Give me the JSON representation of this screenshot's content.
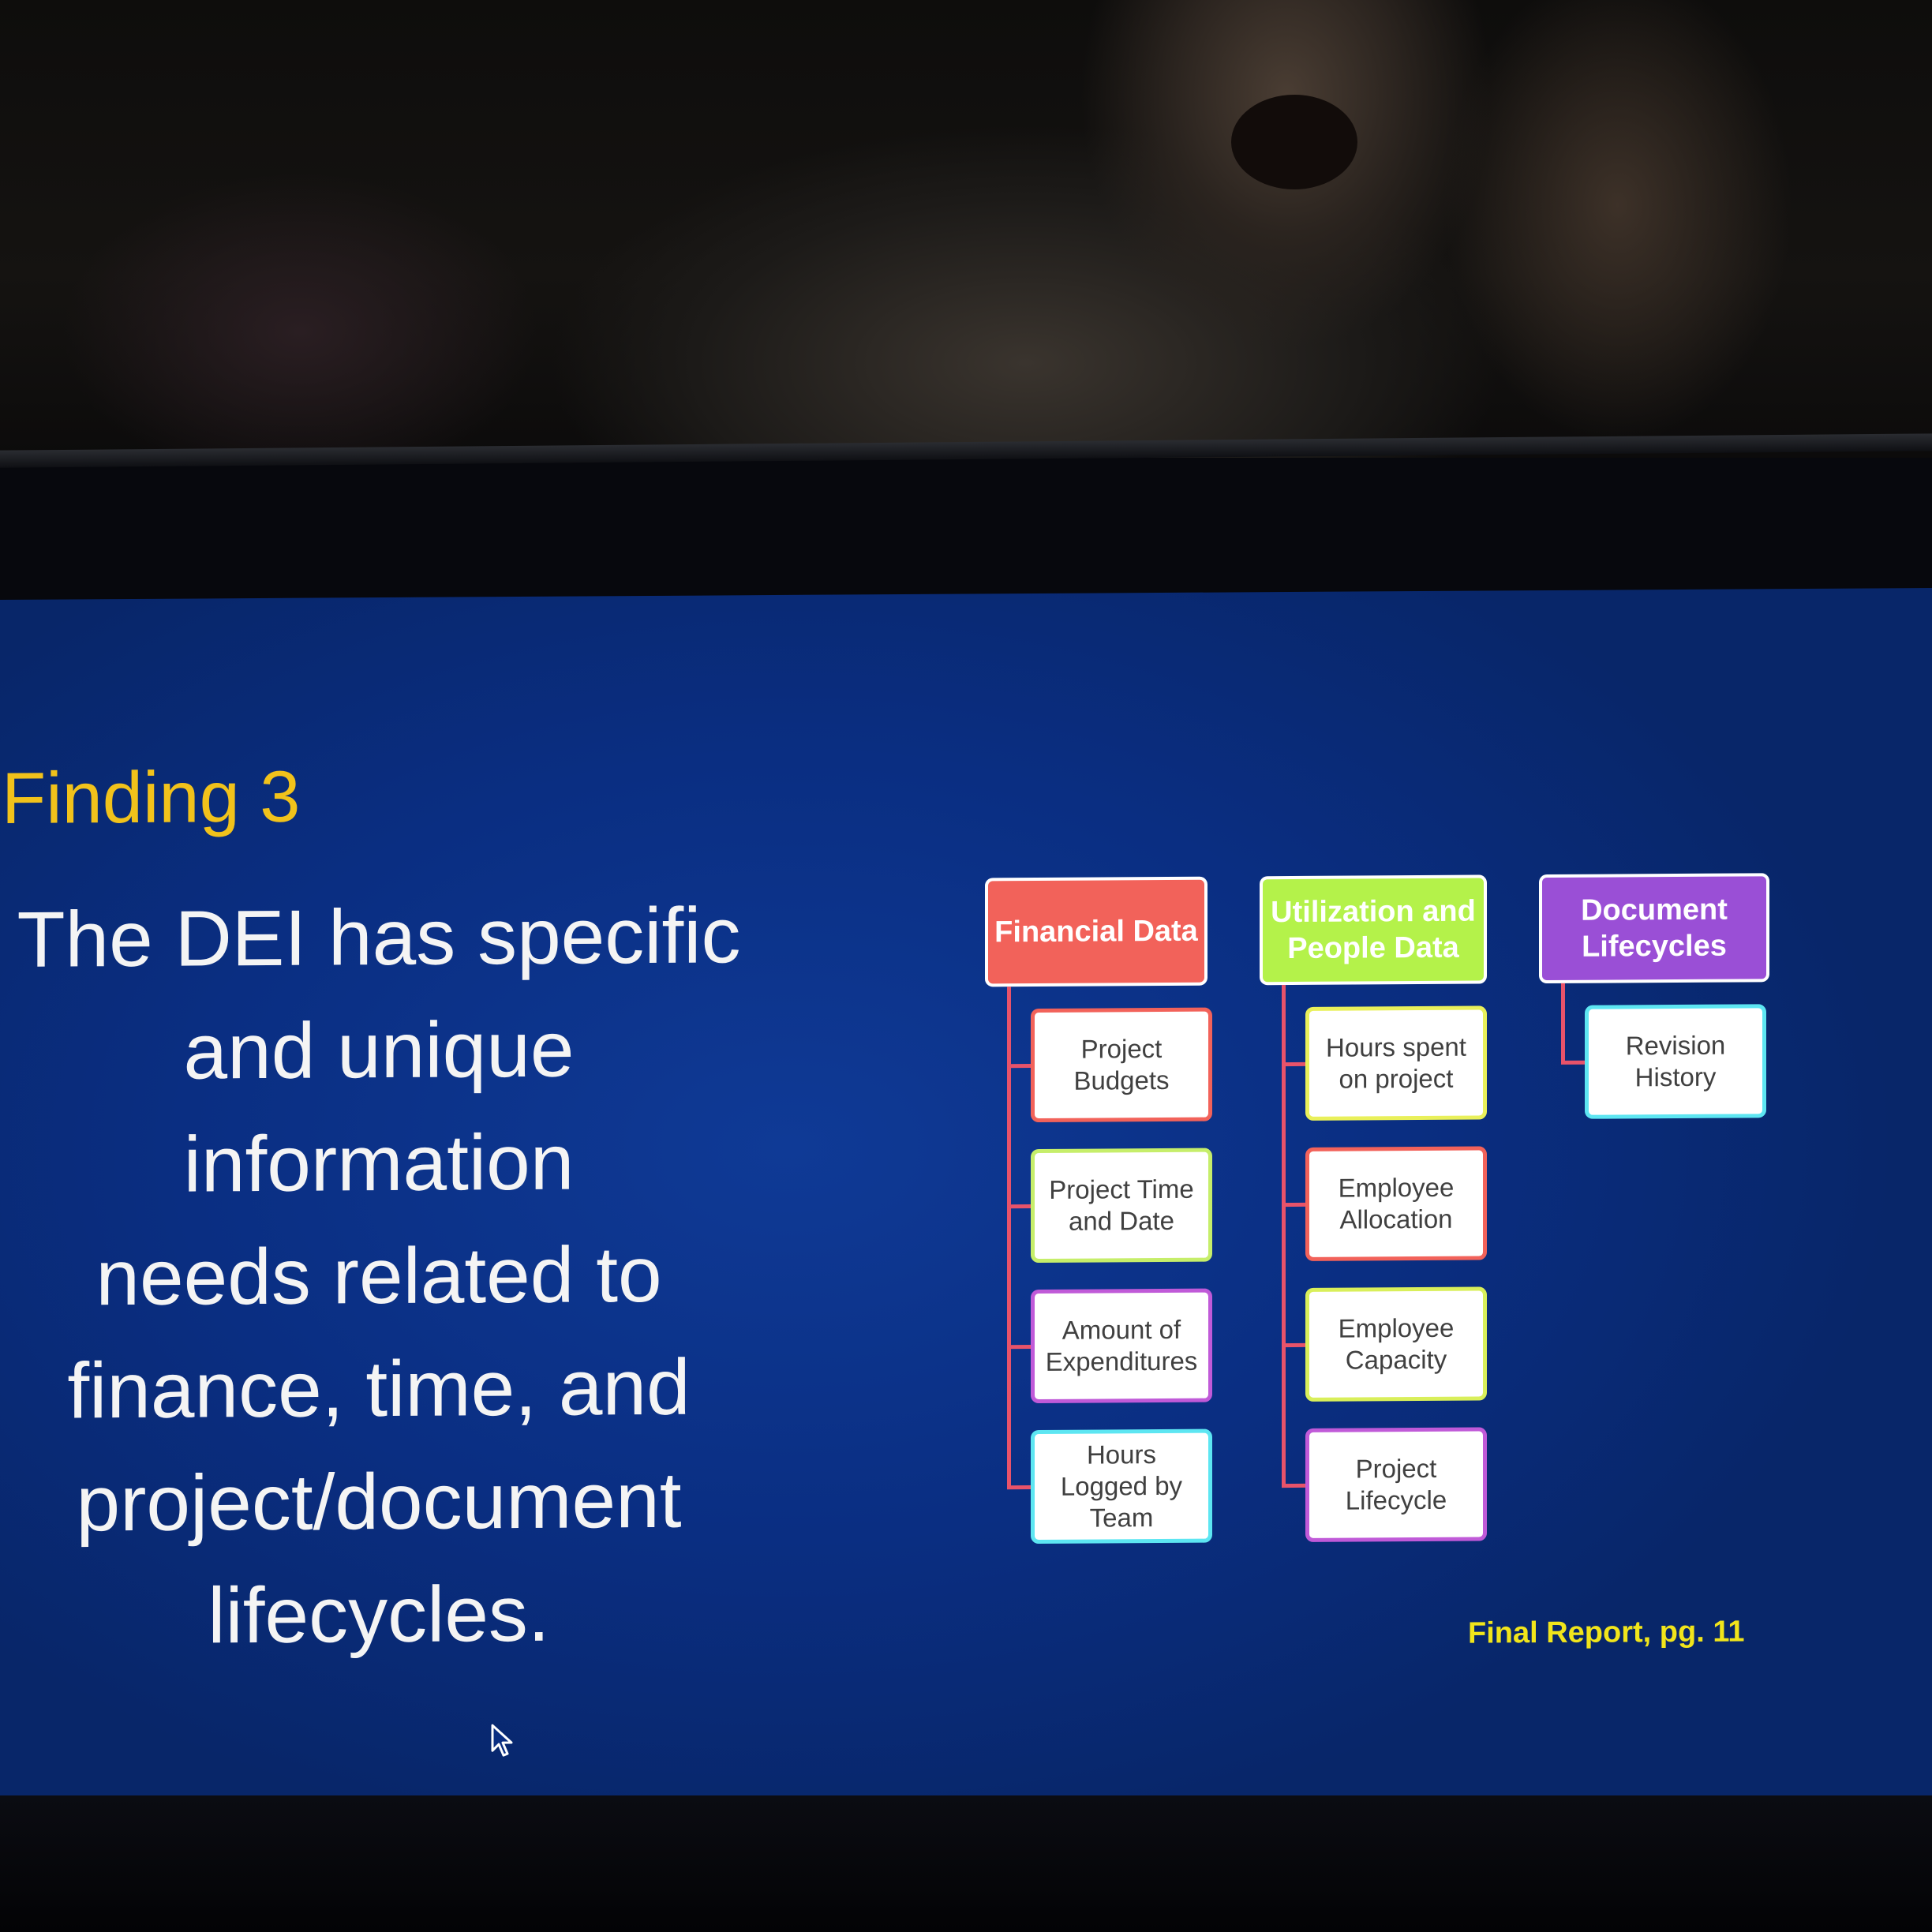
{
  "slide": {
    "title": "Finding 3",
    "body": "The DEI has specific\nand unique information\nneeds related to\nfinance, time, and\nproject/document\nlifecycles.",
    "reference": "Final Report, pg. 11"
  },
  "diagram": {
    "columns": [
      {
        "header": "Financial Data",
        "color": "#f2625a",
        "children": [
          {
            "label": "Project\nBudgets",
            "border": "#f2625a"
          },
          {
            "label": "Project Time\nand  Date",
            "border": "#c6ee6a"
          },
          {
            "label": "Amount of\nExpenditures",
            "border": "#c05ad8"
          },
          {
            "label": "Hours\nLogged by\nTeam",
            "border": "#5de6f2"
          }
        ]
      },
      {
        "header": "Utilization and\nPeople Data",
        "color": "#b4f24a",
        "children": [
          {
            "label": "Hours spent\non project",
            "border": "#e9f05a"
          },
          {
            "label": "Employee\nAllocation",
            "border": "#f2625a"
          },
          {
            "label": "Employee\nCapacity",
            "border": "#d9ef5a"
          },
          {
            "label": "Project\nLifecycle",
            "border": "#c05ad8"
          }
        ]
      },
      {
        "header": "Document\nLifecycles",
        "color": "#9a4fd6",
        "children": [
          {
            "label": "Revision\nHistory",
            "border": "#5de6f2"
          }
        ]
      }
    ]
  }
}
